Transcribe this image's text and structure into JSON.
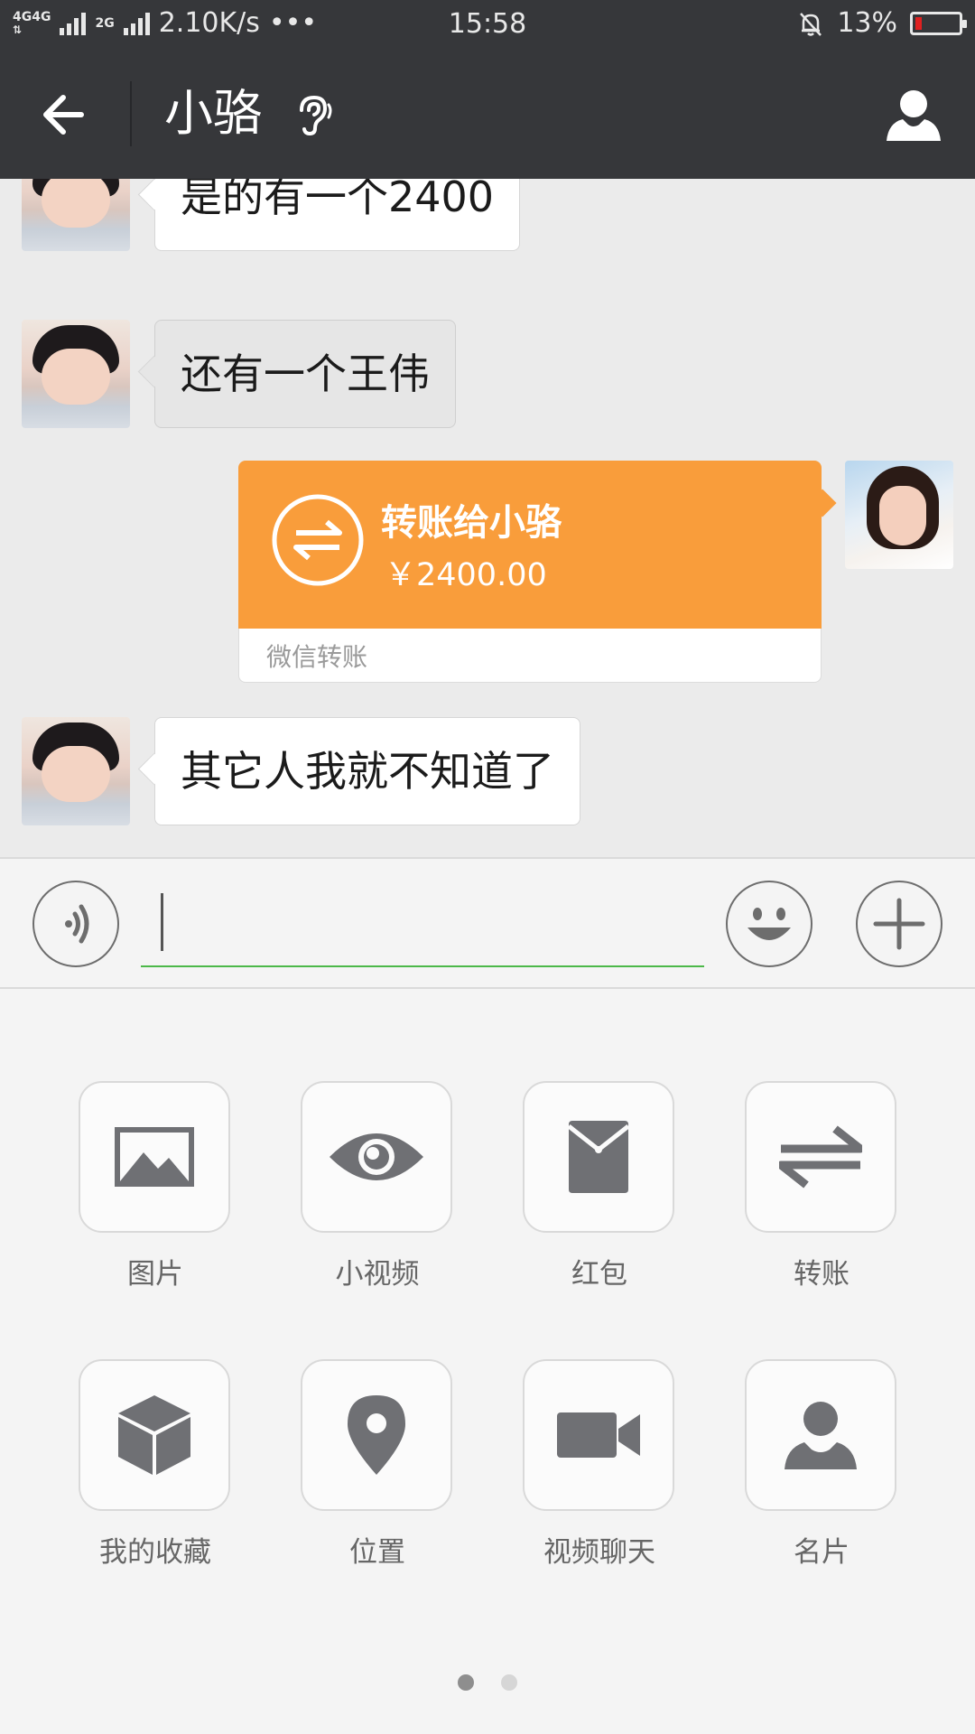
{
  "status_bar": {
    "network_label_1": "4G",
    "network_label_2": "4G",
    "network_label_3": "2G",
    "speed": "2.10K/s",
    "more": "•••",
    "time": "15:58",
    "battery": "13%"
  },
  "header": {
    "title": "小骆"
  },
  "messages": [
    {
      "sender": "other",
      "text": "是的有一个2400"
    },
    {
      "sender": "other",
      "text": "还有一个王伟"
    },
    {
      "sender": "self",
      "type": "transfer",
      "title": "转账给小骆",
      "amount": "￥2400.00",
      "label": "微信转账"
    },
    {
      "sender": "other",
      "text": "其它人我就不知道了"
    }
  ],
  "input": {
    "value": ""
  },
  "panel": {
    "items": [
      {
        "label": "图片",
        "icon": "image-icon"
      },
      {
        "label": "小视频",
        "icon": "eye-icon"
      },
      {
        "label": "红包",
        "icon": "red-packet-icon"
      },
      {
        "label": "转账",
        "icon": "transfer-icon"
      },
      {
        "label": "我的收藏",
        "icon": "cube-icon"
      },
      {
        "label": "位置",
        "icon": "location-pin-icon"
      },
      {
        "label": "视频聊天",
        "icon": "video-camera-icon"
      },
      {
        "label": "名片",
        "icon": "person-card-icon"
      }
    ],
    "page_count": 2,
    "active_page": 1
  },
  "colors": {
    "header_bg": "#36373a",
    "transfer_orange": "#f99d3b",
    "input_underline": "#4cb849",
    "icon_gray": "#6f7074"
  }
}
